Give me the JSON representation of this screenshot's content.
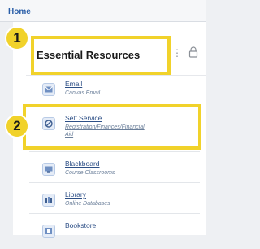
{
  "nav": {
    "home_label": "Home"
  },
  "card": {
    "title": "Essential Resources"
  },
  "badges": [
    "1",
    "2"
  ],
  "items": [
    {
      "title": "Email",
      "subtitle": "Canvas Email",
      "icon": "email-icon"
    },
    {
      "title": "Self Service",
      "subtitle_line1": "Registration/Finances/Financial",
      "subtitle_line2": "Aid",
      "icon": "self-service-icon"
    },
    {
      "title": "Blackboard",
      "subtitle": "Course Classrooms",
      "icon": "blackboard-icon"
    },
    {
      "title": "Library",
      "subtitle": "Online Databases",
      "icon": "library-icon"
    },
    {
      "title": "Bookstore",
      "subtitle": "",
      "icon": "bookstore-icon"
    }
  ],
  "colors": {
    "highlight": "#f1d22a",
    "link": "#2d4f86",
    "nav": "#2a5ea8"
  }
}
